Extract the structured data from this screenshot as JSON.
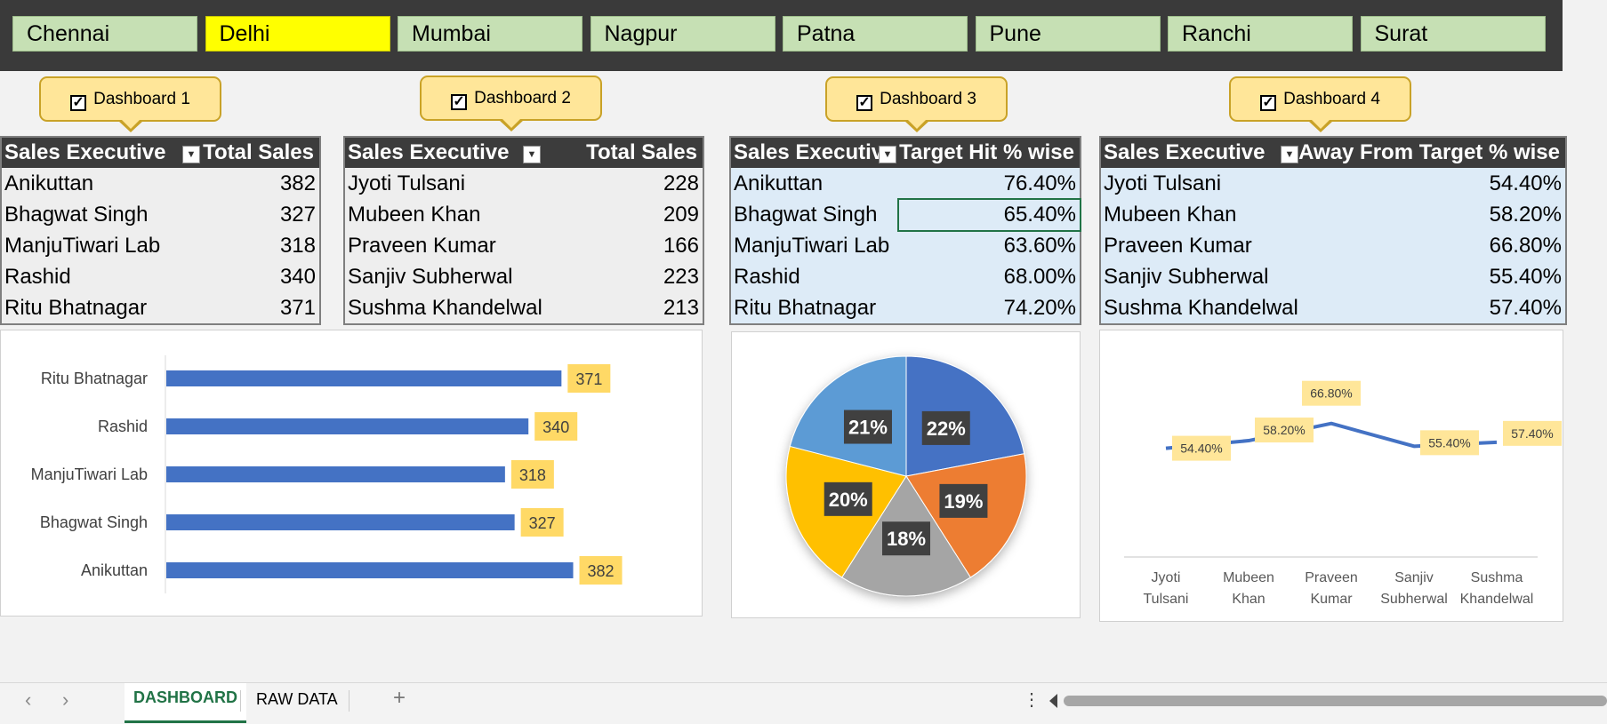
{
  "slicer": {
    "cities": [
      "Chennai",
      "Delhi",
      "Mumbai",
      "Nagpur",
      "Patna",
      "Pune",
      "Ranchi",
      "Surat"
    ],
    "selected": "Delhi"
  },
  "dashboards": [
    "Dashboard 1",
    "Dashboard 2",
    "Dashboard 3",
    "Dashboard 4"
  ],
  "table1": {
    "col1": "Sales Executive",
    "col2": "Total Sales",
    "rows": [
      [
        "Anikuttan",
        "382"
      ],
      [
        "Bhagwat Singh",
        "327"
      ],
      [
        "ManjuTiwari Lab",
        "318"
      ],
      [
        "Rashid",
        "340"
      ],
      [
        "Ritu Bhatnagar",
        "371"
      ]
    ]
  },
  "table2": {
    "col1": "Sales Executive",
    "col2": "Total Sales",
    "rows": [
      [
        "Jyoti Tulsani",
        "228"
      ],
      [
        "Mubeen Khan",
        "209"
      ],
      [
        "Praveen Kumar",
        "166"
      ],
      [
        "Sanjiv Subherwal",
        "223"
      ],
      [
        "Sushma Khandelwal",
        "213"
      ]
    ]
  },
  "table3": {
    "col1": "Sales Executive",
    "col2": "Target Hit % wise",
    "rows": [
      [
        "Anikuttan",
        "76.40%"
      ],
      [
        "Bhagwat Singh",
        "65.40%"
      ],
      [
        "ManjuTiwari Lab",
        "63.60%"
      ],
      [
        "Rashid",
        "68.00%"
      ],
      [
        "Ritu Bhatnagar",
        "74.20%"
      ]
    ]
  },
  "table4": {
    "col1": "Sales Executive",
    "col2": "Away From Target % wise",
    "rows": [
      [
        "Jyoti Tulsani",
        "54.40%"
      ],
      [
        "Mubeen Khan",
        "58.20%"
      ],
      [
        "Praveen Kumar",
        "66.80%"
      ],
      [
        "Sanjiv Subherwal",
        "55.40%"
      ],
      [
        "Sushma Khandelwal",
        "57.40%"
      ]
    ]
  },
  "chart_data": [
    {
      "type": "bar",
      "orientation": "horizontal",
      "categories": [
        "Ritu Bhatnagar",
        "Rashid",
        "ManjuTiwari Lab",
        "Bhagwat Singh",
        "Anikuttan"
      ],
      "values": [
        371,
        340,
        318,
        327,
        382
      ],
      "data_labels": [
        "371",
        "340",
        "318",
        "327",
        "382"
      ],
      "xlim": [
        0,
        430
      ],
      "color": "#4472c4"
    },
    {
      "type": "pie",
      "slices": [
        {
          "label": "22%",
          "value": 22,
          "color": "#4472c4"
        },
        {
          "label": "19%",
          "value": 19,
          "color": "#ed7d31"
        },
        {
          "label": "18%",
          "value": 18,
          "color": "#a5a5a5"
        },
        {
          "label": "20%",
          "value": 20,
          "color": "#ffc000"
        },
        {
          "label": "21%",
          "value": 21,
          "color": "#5b9bd5"
        }
      ]
    },
    {
      "type": "line",
      "categories": [
        "Jyoti Tulsani",
        "Mubeen Khan",
        "Praveen Kumar",
        "Sanjiv Subherwal",
        "Sushma Khandelwal"
      ],
      "values": [
        54.4,
        58.2,
        66.8,
        55.4,
        57.4
      ],
      "data_labels": [
        "54.40%",
        "58.20%",
        "66.80%",
        "55.40%",
        "57.40%"
      ],
      "ylim": [
        0,
        100
      ],
      "color": "#4472c4"
    }
  ],
  "sheet_tabs": {
    "active": "DASHBOARD",
    "other": "RAW DATA",
    "add": "+",
    "nav_prev": "‹",
    "nav_next": "›",
    "more": "⋮"
  }
}
